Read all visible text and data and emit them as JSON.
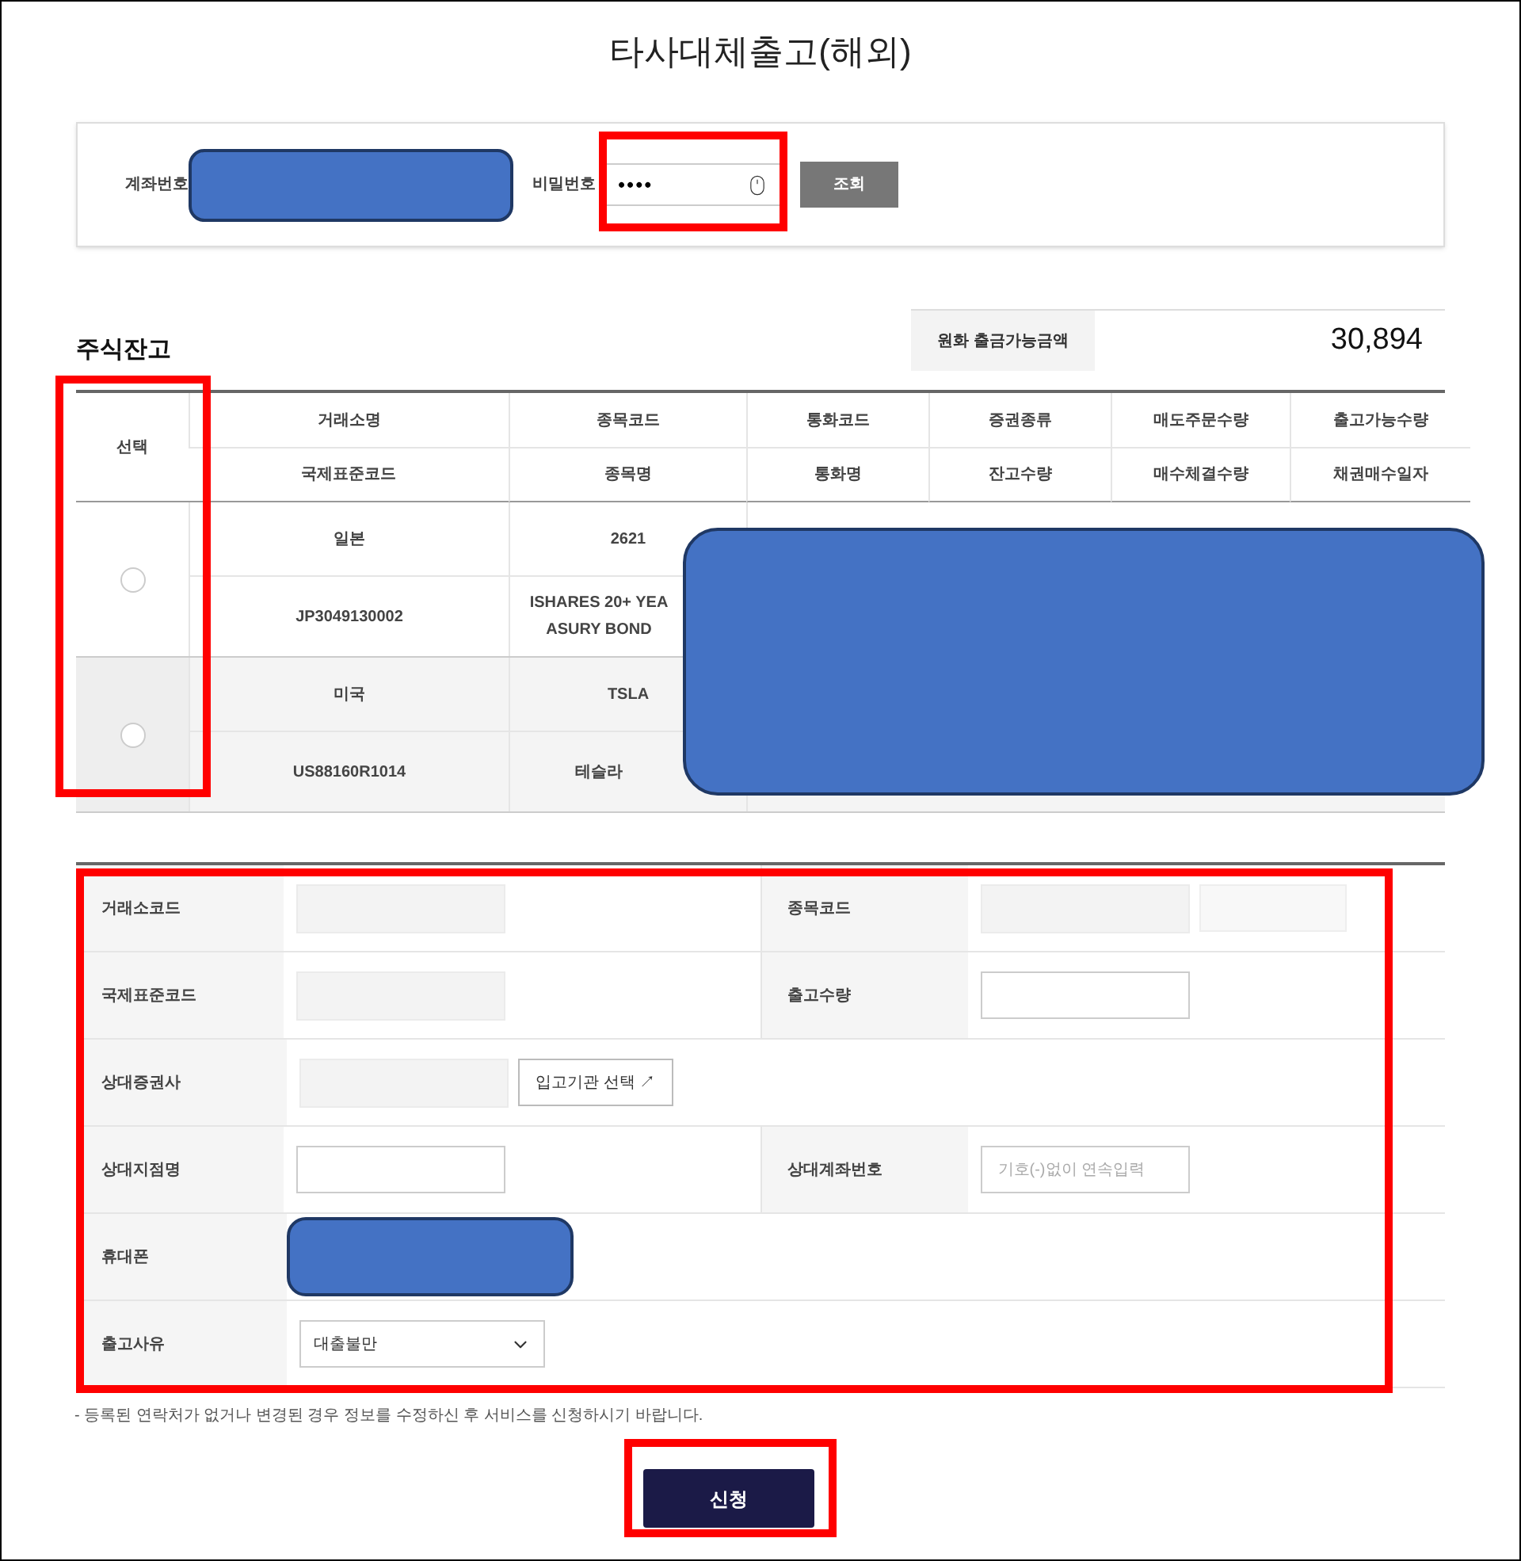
{
  "title": "타사대체출고(해외)",
  "search": {
    "account_label": "계좌번호",
    "account_redacted": true,
    "password_label": "비밀번호",
    "password_value": "••••",
    "password_highlighted": true,
    "button": "조회"
  },
  "balance": {
    "section_title": "주식잔고",
    "label": "원화 출금가능금액",
    "value": "30,894"
  },
  "table": {
    "select_header": "선택",
    "select_highlighted": true,
    "redacted": true,
    "header_top": [
      "거래소명",
      "종목코드",
      "통화코드",
      "증권종류",
      "매도주문수량",
      "출고가능수량"
    ],
    "header_bottom": [
      "국제표준코드",
      "종목명",
      "통화명",
      "잔고수량",
      "매수체결수량",
      "채권매수일자"
    ],
    "rows": [
      {
        "selected": false,
        "shaded": false,
        "exchange": "일본",
        "code": "2621",
        "isin": "JP3049130002",
        "name": "ISHARES 20+ YEA\nASURY BOND"
      },
      {
        "selected": false,
        "shaded": true,
        "exchange": "미국",
        "code": "TSLA",
        "isin": "US88160R1014",
        "name": "테슬라"
      }
    ]
  },
  "form": {
    "highlighted": true,
    "rows": [
      {
        "cells": [
          {
            "label": "거래소코드",
            "fields": [
              {
                "kind": "readonly"
              }
            ]
          },
          {
            "label": "종목코드",
            "fields": [
              {
                "kind": "readonly"
              },
              {
                "kind": "readonly-light"
              }
            ]
          }
        ]
      },
      {
        "cells": [
          {
            "label": "국제표준코드",
            "fields": [
              {
                "kind": "readonly"
              }
            ]
          },
          {
            "label": "출고수량",
            "fields": [
              {
                "kind": "input"
              }
            ]
          }
        ]
      },
      {
        "cells": [
          {
            "label": "상대증권사",
            "fields": [
              {
                "kind": "readonly"
              },
              {
                "kind": "button",
                "label": "입고기관 선택 ↗"
              }
            ]
          }
        ]
      },
      {
        "cells": [
          {
            "label": "상대지점명",
            "fields": [
              {
                "kind": "input"
              }
            ]
          },
          {
            "label": "상대계좌번호",
            "fields": [
              {
                "kind": "input",
                "placeholder": "기호(-)없이 연속입력"
              }
            ]
          }
        ]
      },
      {
        "cells": [
          {
            "label": "휴대폰",
            "fields": [
              {
                "kind": "redacted"
              }
            ]
          }
        ]
      },
      {
        "cells": [
          {
            "label": "출고사유",
            "fields": [
              {
                "kind": "select",
                "value": "대출불만"
              }
            ]
          }
        ]
      }
    ]
  },
  "note": "- 등록된 연락처가 없거나 변경된 경우 정보를 수정하신 후 서비스를 신청하시기 바랍니다.",
  "submit": {
    "label": "신청",
    "highlighted": true
  }
}
